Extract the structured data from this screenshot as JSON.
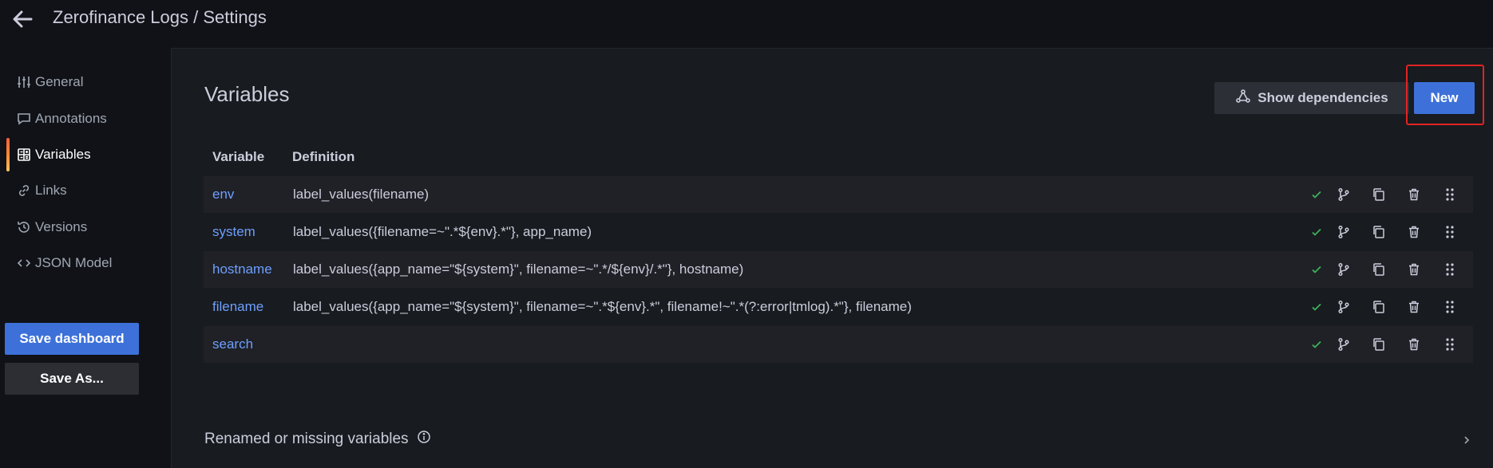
{
  "header": {
    "title": "Zerofinance Logs / Settings"
  },
  "sidebar": {
    "items": [
      {
        "label": "General",
        "icon": "sliders-icon"
      },
      {
        "label": "Annotations",
        "icon": "comment-icon"
      },
      {
        "label": "Variables",
        "icon": "calculator-icon",
        "active": true
      },
      {
        "label": "Links",
        "icon": "link-icon"
      },
      {
        "label": "Versions",
        "icon": "history-icon"
      },
      {
        "label": "JSON Model",
        "icon": "code-icon"
      }
    ],
    "save_dashboard": "Save dashboard",
    "save_as": "Save As..."
  },
  "variables": {
    "section_title": "Variables",
    "show_dependencies": "Show dependencies",
    "new_button": "New",
    "columns": [
      "Variable",
      "Definition"
    ],
    "rows": [
      {
        "name": "env",
        "definition": "label_values(filename)"
      },
      {
        "name": "system",
        "definition": "label_values({filename=~\".*${env}.*\"}, app_name)"
      },
      {
        "name": "hostname",
        "definition": "label_values({app_name=\"${system}\", filename=~\".*/${env}/.*\"}, hostname)"
      },
      {
        "name": "filename",
        "definition": "label_values({app_name=\"${system}\", filename=~\".*${env}.*\", filename!~\".*(?:error|tmlog).*\"}, filename)"
      },
      {
        "name": "search",
        "definition": ""
      }
    ],
    "renamed_title": "Renamed or missing variables"
  },
  "colors": {
    "accent": "#3d71d9",
    "link": "#6e9fff",
    "check": "#3eb15b",
    "highlight": "#e02424"
  }
}
